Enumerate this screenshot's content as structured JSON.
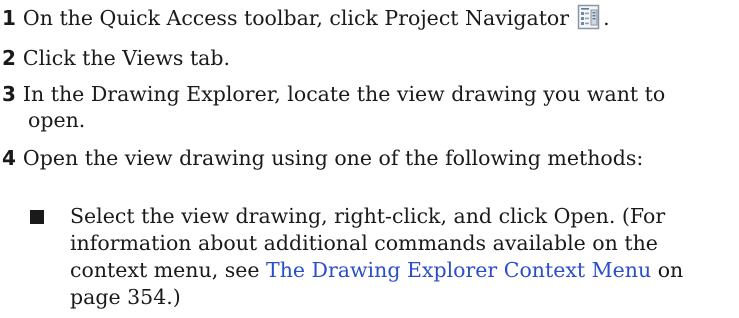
{
  "steps": [
    {
      "number": "1",
      "text": "On the Quick Access toolbar, click Project Navigator",
      "icon": "project-navigator-icon",
      "after_icon": "."
    },
    {
      "number": "2",
      "text": "Click the Views tab."
    },
    {
      "number": "3",
      "line1": "In the Drawing Explorer, locate the view drawing you want to",
      "line2": "open."
    },
    {
      "number": "4",
      "text": "Open the view drawing using one of the following methods:"
    }
  ],
  "bullet": {
    "line1": "Select the view drawing, right-click, and click Open. (For",
    "line2": "information about additional commands available on the",
    "line3_before_link": "context menu, see ",
    "link_text": "The Drawing Explorer Context Menu",
    "line3_after_link": " on",
    "line4": "page 354.)"
  },
  "colors": {
    "text": "#1a1a1a",
    "link": "#2a4fc9"
  }
}
